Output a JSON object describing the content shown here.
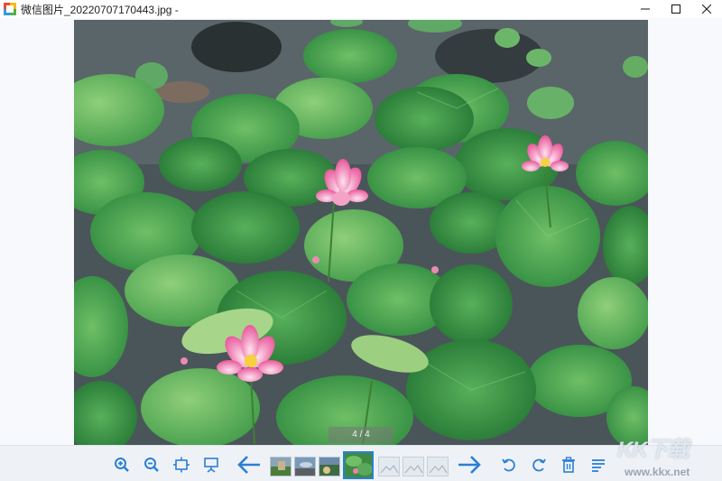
{
  "window": {
    "title": "微信图片_20220707170443.jpg -",
    "controls": {
      "minimize": "minimize",
      "maximize": "maximize",
      "close": "close"
    }
  },
  "viewer": {
    "page_counter": "4 / 4",
    "current_index": 4,
    "total": 4
  },
  "toolbar": {
    "buttons": [
      "zoom-in-icon",
      "zoom-out-icon",
      "fit-to-window-icon",
      "slideshow-icon",
      "prev-arrow-icon",
      "next-arrow-icon",
      "rotate-left-icon",
      "rotate-right-icon",
      "delete-icon",
      "menu-icon"
    ],
    "accent_color": "#2b7fd6"
  },
  "watermark": {
    "logo": "KK下载",
    "url": "www.kkx.net"
  }
}
